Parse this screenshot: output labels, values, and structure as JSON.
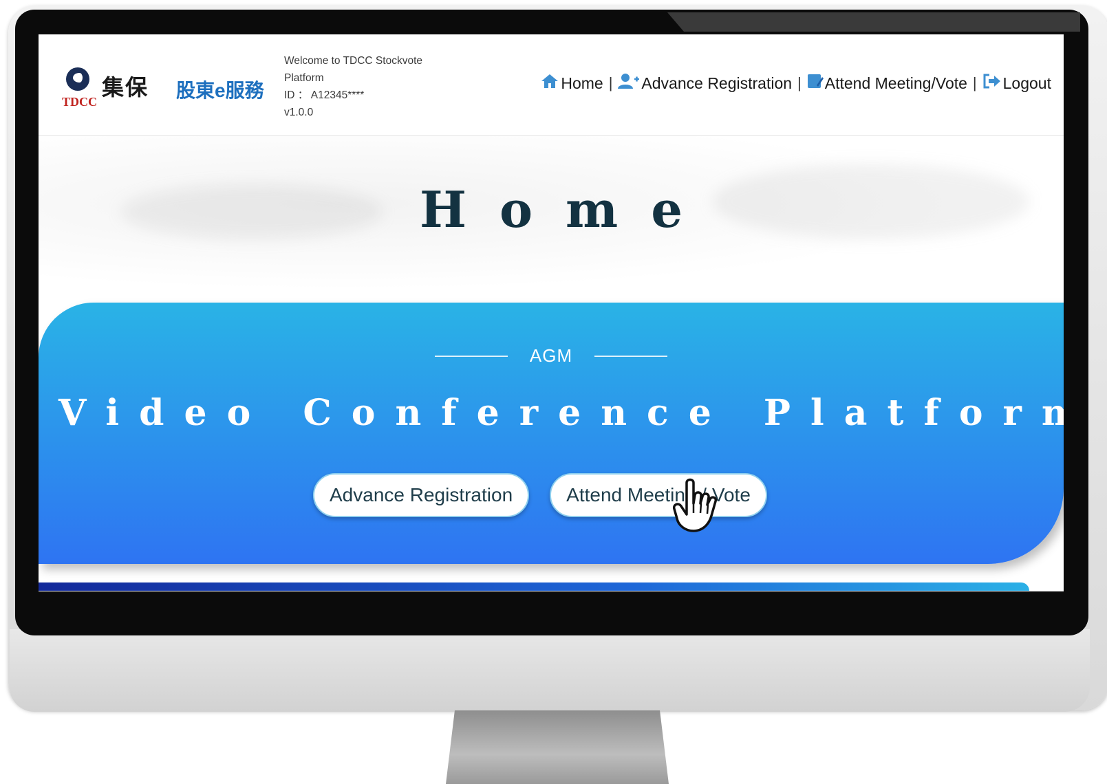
{
  "header": {
    "logo_tdcc": "TDCC",
    "logo_chinese": "集保",
    "logo_service": "股東e服務",
    "welcome_line1": "Welcome to TDCC Stockvote",
    "welcome_line2": "Platform",
    "id_line": "ID ： A12345****",
    "version": "v1.0.0"
  },
  "nav": {
    "items": [
      {
        "label": "Home",
        "icon": "home-icon"
      },
      {
        "label": "Advance Registration",
        "icon": "user-plus-icon"
      },
      {
        "label": "Attend Meeting/Vote",
        "icon": "edit-icon"
      },
      {
        "label": "Logout",
        "icon": "sign-out-icon"
      }
    ],
    "separator": "|"
  },
  "hero": {
    "title": "Home"
  },
  "banner": {
    "tag": "AGM",
    "title": "Video Conference Platform",
    "buttons": [
      {
        "label": "Advance Registration"
      },
      {
        "label": "Attend Meeting / Vote"
      }
    ]
  },
  "colors": {
    "accent_blue": "#1d6fbe",
    "banner_top": "#2ab3e6",
    "banner_bottom": "#2e74f2",
    "title_dark": "#133241",
    "tdcc_red": "#c0231f"
  }
}
